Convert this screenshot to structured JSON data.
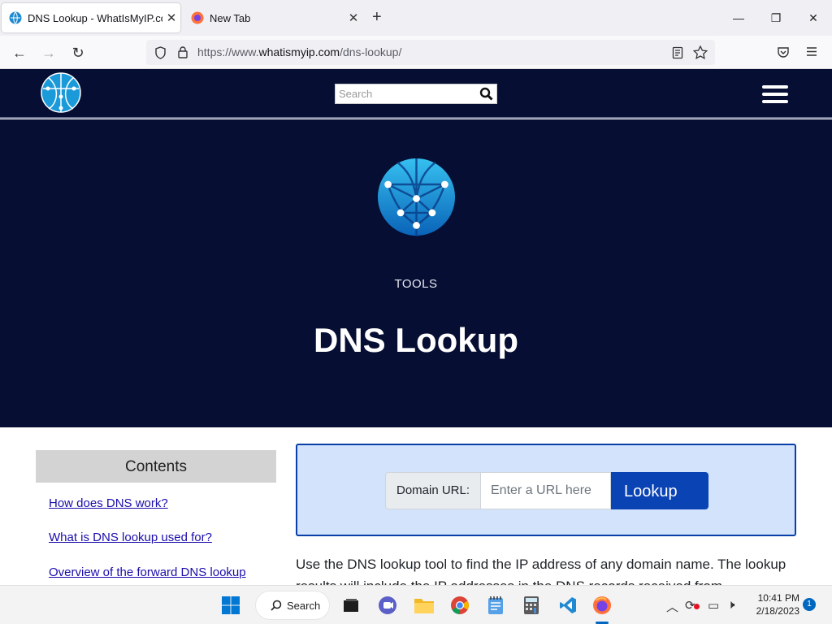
{
  "browser": {
    "tabs": [
      {
        "title": "DNS Lookup - WhatIsMyIP.com",
        "active": true
      },
      {
        "title": "New Tab",
        "active": false
      }
    ],
    "url_prefix": "https://www.",
    "url_domain": "whatismyip.com",
    "url_path": "/dns-lookup/"
  },
  "site": {
    "search_placeholder": "Search",
    "hero_kicker": "TOOLS",
    "hero_title": "DNS Lookup",
    "colors": {
      "navy": "#060e33",
      "primary": "#0a43b4",
      "panel": "#d3e3fb"
    }
  },
  "toc": {
    "title": "Contents",
    "items": [
      "How does DNS work?",
      "What is DNS lookup used for?",
      "Overview of the forward DNS lookup process"
    ]
  },
  "lookup": {
    "label": "Domain URL:",
    "placeholder": "Enter a URL here",
    "button": "Lookup"
  },
  "body": {
    "intro": "Use the DNS lookup tool to find the IP address of any domain name. The lookup results will include the IP addresses in the DNS records received from"
  },
  "taskbar": {
    "search_label": "Search",
    "time": "10:41 PM",
    "date": "2/18/2023",
    "notification_count": "1"
  }
}
